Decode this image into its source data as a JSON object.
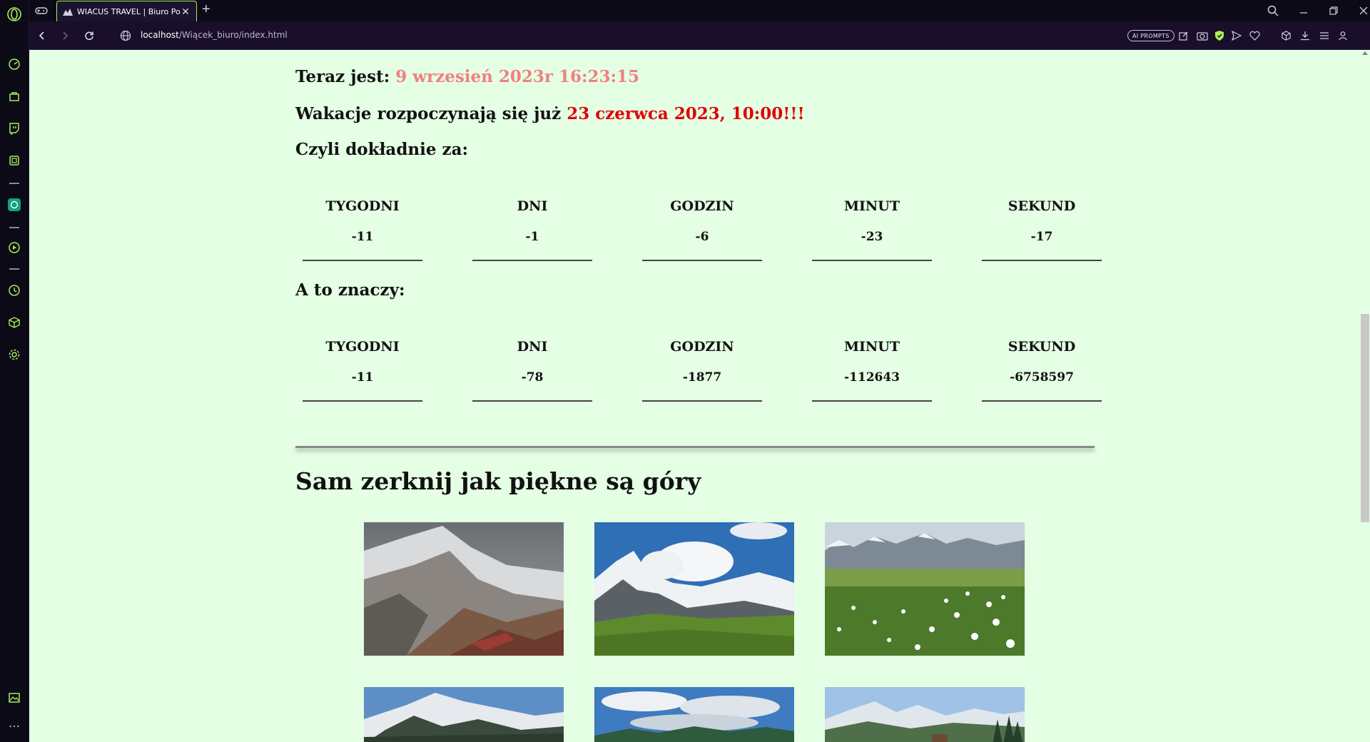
{
  "browser": {
    "tab_title": "WIACUS TRAVEL | Biuro Po",
    "url_host": "localhost",
    "url_path": "/Wiącek_biuro/index.html",
    "ai_prompts_label": "AI PROMPTS",
    "accent_color": "#a6f05a"
  },
  "page": {
    "background": "#e4ffe4",
    "now_prefix": "Teraz jest:",
    "now_value": "9 wrzesień 2023r 16:23:15",
    "vacation_prefix": "Wakacje rozpoczynają się już",
    "vacation_date": "23 czerwca 2023, 10:00!!!",
    "exactly_label": "Czyli dokładnie za:",
    "meaning_label": "A to znaczy:",
    "countdown_exact": [
      {
        "label": "TYGODNI",
        "value": "-11"
      },
      {
        "label": "DNI",
        "value": "-1"
      },
      {
        "label": "GODZIN",
        "value": "-6"
      },
      {
        "label": "MINUT",
        "value": "-23"
      },
      {
        "label": "SEKUND",
        "value": "-17"
      }
    ],
    "countdown_total": [
      {
        "label": "TYGODNI",
        "value": "-11"
      },
      {
        "label": "DNI",
        "value": "-78"
      },
      {
        "label": "GODZIN",
        "value": "-1877"
      },
      {
        "label": "MINUT",
        "value": "-112643"
      },
      {
        "label": "SEKUND",
        "value": "-6758597"
      }
    ],
    "gallery_title": "Sam zerknij jak piękne są góry",
    "gallery": [
      "mountain-photo-1",
      "mountain-photo-2",
      "mountain-photo-3",
      "mountain-photo-4",
      "mountain-photo-5",
      "mountain-photo-6"
    ]
  }
}
